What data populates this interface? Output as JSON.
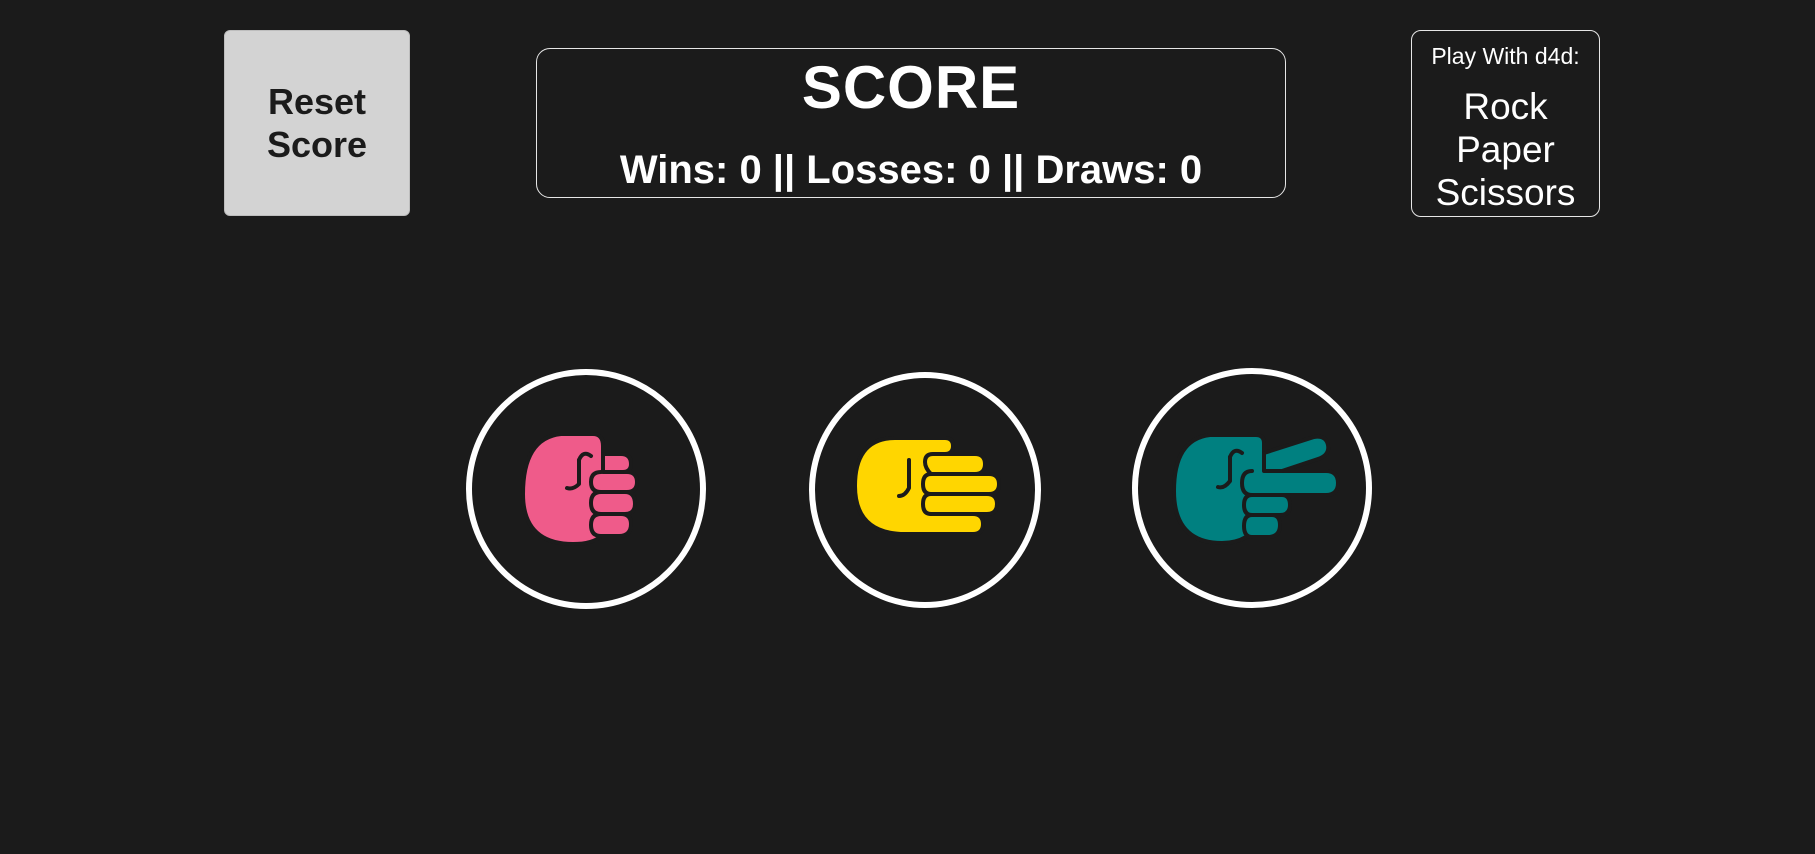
{
  "reset": {
    "line1": "Reset",
    "line2": "Score"
  },
  "score": {
    "title": "SCORE",
    "line": "Wins: 0 || Losses: 0 || Draws: 0",
    "wins": 0,
    "losses": 0,
    "draws": 0
  },
  "info": {
    "subtitle": "Play With d4d:",
    "game_line1": "Rock",
    "game_line2": "Paper",
    "game_line3": "Scissors"
  },
  "choices": [
    {
      "id": "rock",
      "icon": "rock-fist-icon",
      "color": "#ef5b8a"
    },
    {
      "id": "paper",
      "icon": "paper-hand-icon",
      "color": "#ffd600"
    },
    {
      "id": "scissors",
      "icon": "scissors-hand-icon",
      "color": "#008080"
    }
  ],
  "colors": {
    "background": "#1b1b1b",
    "reset_button": "#d3d3d3",
    "text": "#ffffff"
  }
}
